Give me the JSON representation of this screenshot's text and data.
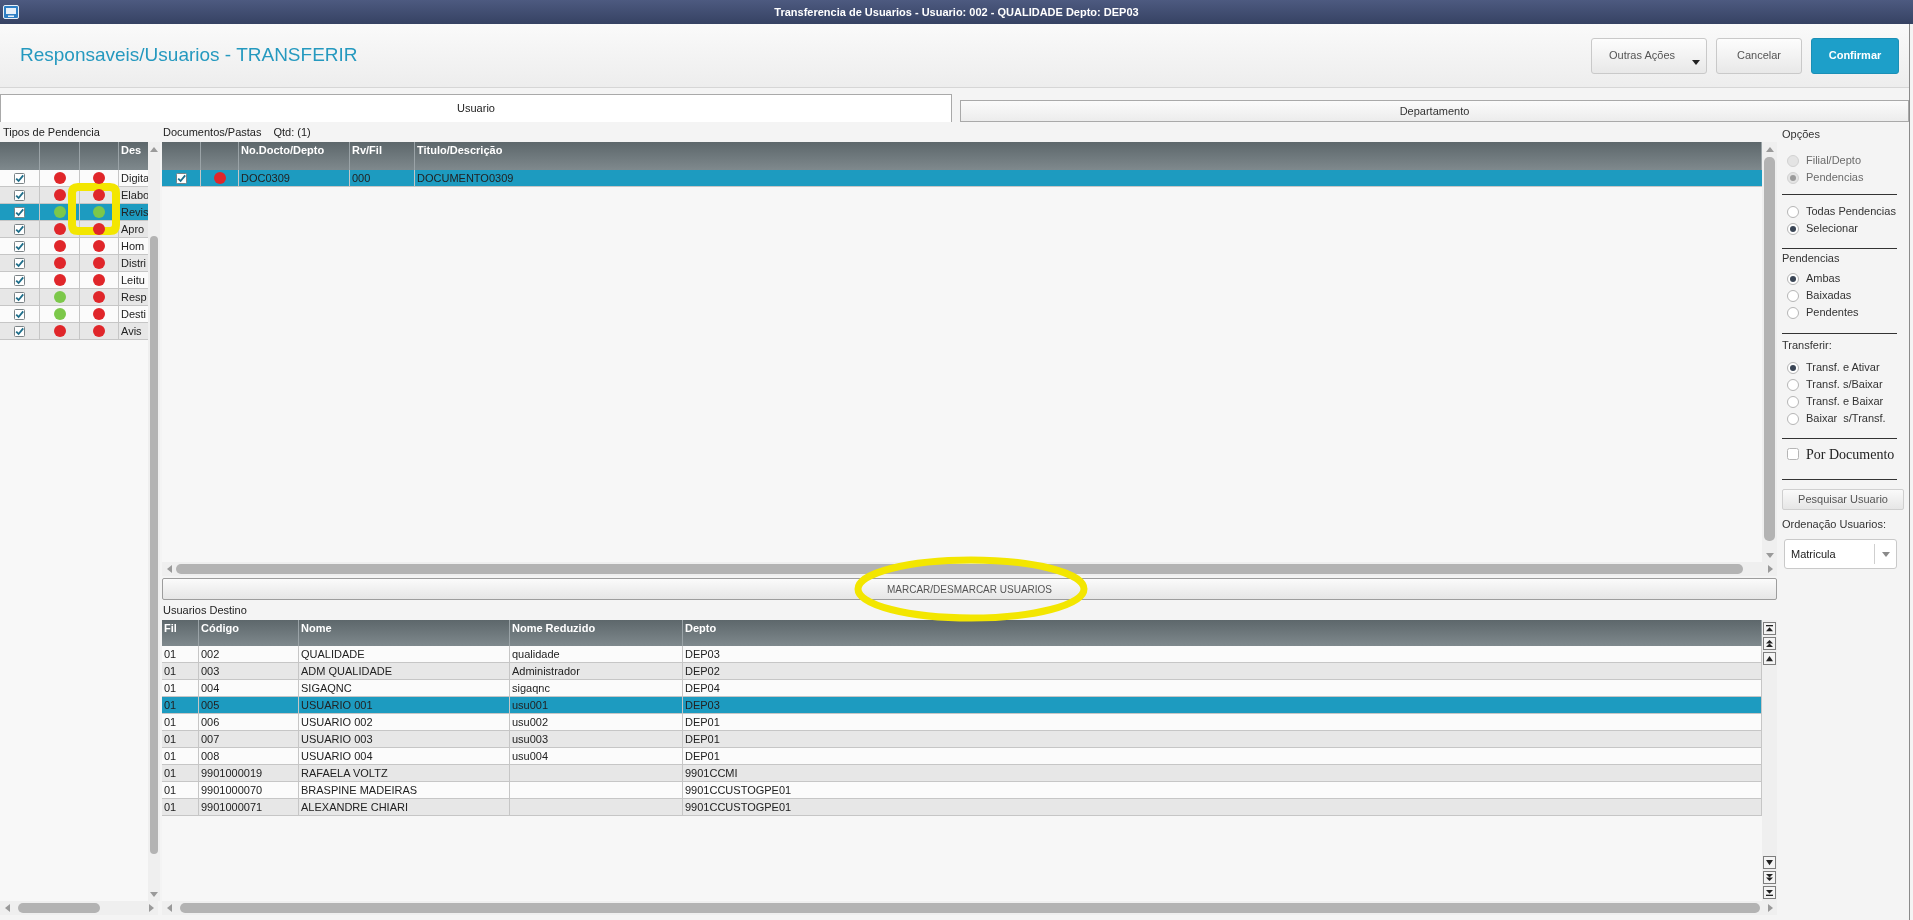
{
  "window": {
    "title": "Transferencia de Usuarios - Usuario: 002 - QUALIDADE Depto: DEP03"
  },
  "header": {
    "title": "Responsaveis/Usuarios - TRANSFERIR",
    "buttons": [
      {
        "label": "Outras Ações",
        "kind": "menu"
      },
      {
        "label": "Cancelar",
        "kind": "secondary"
      },
      {
        "label": "Confirmar",
        "kind": "primary"
      }
    ]
  },
  "tabs": [
    {
      "label": "Usuario",
      "selected": true
    },
    {
      "label": "Departamento",
      "selected": false
    }
  ],
  "pending_types": {
    "title": "Tipos de Pendencia",
    "column_4": "Des",
    "rows": [
      {
        "checked": true,
        "selected": false,
        "lights": [
          {
            "color": "#e0262a"
          },
          {
            "color": "#e0262a"
          }
        ],
        "description": "Digita"
      },
      {
        "checked": true,
        "selected": false,
        "lights": [
          {
            "color": "#e0262a"
          },
          {
            "color": "#e0262a"
          }
        ],
        "description": "Elabo"
      },
      {
        "checked": true,
        "selected": true,
        "lights": [
          {
            "color": "#7cc84a"
          },
          {
            "color": "#7cc84a"
          }
        ],
        "description": "Revis"
      },
      {
        "checked": true,
        "selected": false,
        "lights": [
          {
            "color": "#e0262a"
          },
          {
            "color": "#e0262a"
          }
        ],
        "description": "Apro"
      },
      {
        "checked": true,
        "selected": false,
        "lights": [
          {
            "color": "#e0262a"
          },
          {
            "color": "#e0262a"
          }
        ],
        "description": "Hom"
      },
      {
        "checked": true,
        "selected": false,
        "lights": [
          {
            "color": "#e0262a"
          },
          {
            "color": "#e0262a"
          }
        ],
        "description": "Distri"
      },
      {
        "checked": true,
        "selected": false,
        "lights": [
          {
            "color": "#e0262a"
          },
          {
            "color": "#e0262a"
          }
        ],
        "description": "Leitu"
      },
      {
        "checked": true,
        "selected": false,
        "lights": [
          {
            "color": "#7cc84a"
          },
          {
            "color": "#e0262a"
          }
        ],
        "description": "Resp"
      },
      {
        "checked": true,
        "selected": false,
        "lights": [
          {
            "color": "#7cc84a"
          },
          {
            "color": "#e0262a"
          }
        ],
        "description": "Desti"
      },
      {
        "checked": true,
        "selected": false,
        "lights": [
          {
            "color": "#e0262a"
          },
          {
            "color": "#e0262a"
          }
        ],
        "description": "Avis"
      }
    ]
  },
  "documents": {
    "title": "Documentos/Pastas",
    "count": "Qtd: (1)",
    "columns": [
      "No.Docto/Depto",
      "Rv/Fil",
      "Titulo/Descrição"
    ],
    "rows": [
      {
        "checked": true,
        "selected": true,
        "light": {
          "color": "#e0262a"
        },
        "doc": "DOC0309",
        "rev": "000",
        "description": "DOCUMENTO0309"
      }
    ]
  },
  "mark_button": {
    "label": "MARCAR/DESMARCAR USUARIOS"
  },
  "destination_users": {
    "title": "Usuarios Destino",
    "columns": [
      "Fil",
      "Código",
      "Nome",
      "Nome Reduzido",
      "Depto"
    ],
    "rows": [
      {
        "selected": false,
        "fil": "01",
        "code": "002",
        "name": "QUALIDADE",
        "short_name": "qualidade",
        "dept": "DEP03"
      },
      {
        "selected": false,
        "fil": "01",
        "code": "003",
        "name": "ADM QUALIDADE",
        "short_name": "Administrador",
        "dept": "DEP02"
      },
      {
        "selected": false,
        "fil": "01",
        "code": "004",
        "name": "SIGAQNC",
        "short_name": "sigaqnc",
        "dept": "DEP04"
      },
      {
        "selected": true,
        "fil": "01",
        "code": "005",
        "name": "USUARIO 001",
        "short_name": "usu001",
        "dept": "DEP03"
      },
      {
        "selected": false,
        "fil": "01",
        "code": "006",
        "name": "USUARIO 002",
        "short_name": "usu002",
        "dept": "DEP01"
      },
      {
        "selected": false,
        "fil": "01",
        "code": "007",
        "name": "USUARIO 003",
        "short_name": "usu003",
        "dept": "DEP01"
      },
      {
        "selected": false,
        "fil": "01",
        "code": "008",
        "name": "USUARIO 004",
        "short_name": "usu004",
        "dept": "DEP01"
      },
      {
        "selected": false,
        "fil": "01",
        "code": "9901000019",
        "name": "RAFAELA VOLTZ",
        "dept": "9901CCMI"
      },
      {
        "selected": false,
        "fil": "01",
        "code": "9901000070",
        "name": "BRASPINE MADEIRAS",
        "dept": "9901CCUSTOGPE01"
      },
      {
        "selected": false,
        "fil": "01",
        "code": "9901000071",
        "name": "ALEXANDRE CHIARI",
        "dept": "9901CCUSTOGPE01"
      }
    ]
  },
  "options": {
    "title": "Opções",
    "groups": [
      {
        "items": [
          {
            "label": "Filial/Depto",
            "selected": false,
            "disabled": true
          },
          {
            "label": "Pendencias",
            "selected": true,
            "disabled": true
          }
        ]
      },
      {
        "items": [
          {
            "label": "Todas Pendencias",
            "selected": false,
            "disabled": false
          },
          {
            "label": "Selecionar",
            "selected": true,
            "disabled": false
          }
        ]
      },
      {
        "title": "Pendencias",
        "items": [
          {
            "label": "Ambas",
            "selected": true,
            "disabled": false
          },
          {
            "label": "Baixadas",
            "selected": false,
            "disabled": false
          },
          {
            "label": "Pendentes",
            "selected": false,
            "disabled": false
          }
        ]
      },
      {
        "title": "Transferir:",
        "items": [
          {
            "label": "Transf. e Ativar",
            "selected": true,
            "disabled": false
          },
          {
            "label": "Transf. s/Baixar",
            "selected": false,
            "disabled": false
          },
          {
            "label": "Transf. e Baixar",
            "selected": false,
            "disabled": false
          },
          {
            "label": "Baixar  s/Transf.",
            "selected": false,
            "disabled": false
          }
        ]
      }
    ],
    "by_document": {
      "label": "Por Documento",
      "checked": false
    },
    "search_button": {
      "label": "Pesquisar Usuario"
    },
    "sort": {
      "label": "Ordenação Usuarios:",
      "value": "Matricula"
    }
  }
}
